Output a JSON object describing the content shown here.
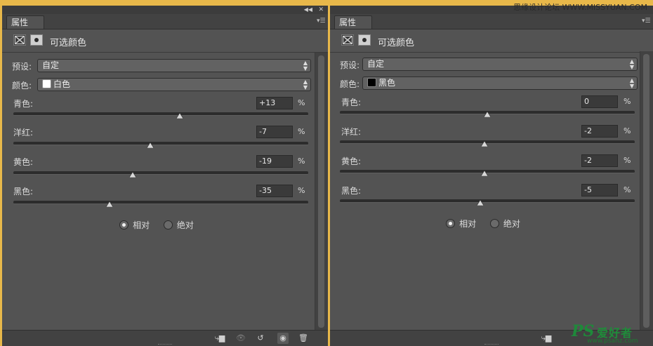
{
  "panels": [
    {
      "tab_label": "属性",
      "header_title": "可选颜色",
      "preset_label": "预设:",
      "preset_value": "自定",
      "color_label": "颜色:",
      "color_value": "白色",
      "color_swatch": "#ffffff",
      "sliders": [
        {
          "label": "青色:",
          "value": "+13",
          "unit": "%",
          "level": 0.565
        },
        {
          "label": "洋红:",
          "value": "-7",
          "unit": "%",
          "level": 0.465
        },
        {
          "label": "黄色:",
          "value": "-19",
          "unit": "%",
          "level": 0.405
        },
        {
          "label": "黑色:",
          "value": "-35",
          "unit": "%",
          "level": 0.325
        }
      ],
      "method_relative": "相对",
      "method_absolute": "绝对",
      "method_selected": "relative"
    },
    {
      "tab_label": "属性",
      "header_title": "可选颜色",
      "preset_label": "预设:",
      "preset_value": "自定",
      "color_label": "颜色:",
      "color_value": "黑色",
      "color_swatch": "#000000",
      "sliders": [
        {
          "label": "青色:",
          "value": "0",
          "unit": "%",
          "level": 0.5
        },
        {
          "label": "洋红:",
          "value": "-2",
          "unit": "%",
          "level": 0.49
        },
        {
          "label": "黄色:",
          "value": "-2",
          "unit": "%",
          "level": 0.49
        },
        {
          "label": "黑色:",
          "value": "-5",
          "unit": "%",
          "level": 0.475
        }
      ],
      "method_relative": "相对",
      "method_absolute": "绝对",
      "method_selected": "relative"
    }
  ],
  "watermark_top": "思缘设计论坛 WWW.MISSYUAN.COM",
  "watermark_brand": "PS",
  "watermark_cn": "爱好者",
  "watermark_url": "www.psahz.com",
  "colors": {
    "panel_bg": "#535353",
    "frame_accent": "#e8b84a",
    "watermark_green": "#1e8a3a"
  }
}
